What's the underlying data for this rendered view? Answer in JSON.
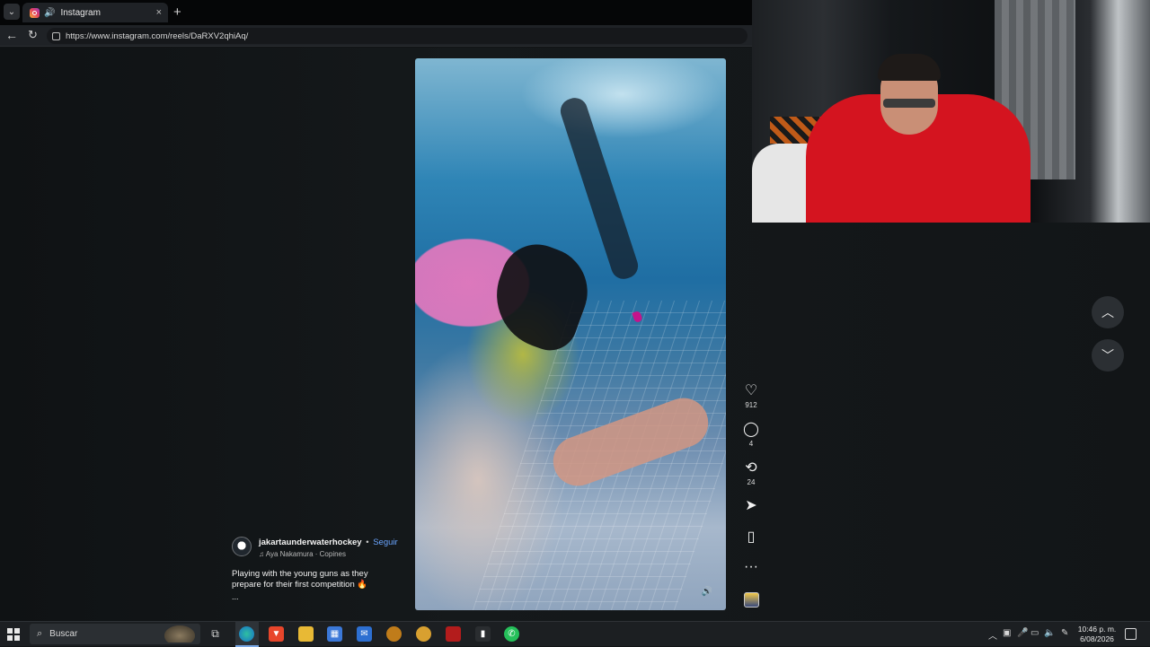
{
  "browser": {
    "tab_title": "Instagram",
    "new_tab": "+",
    "close_tab": "×",
    "url": "https://www.instagram.com/reels/DaRXV2qhiAq/"
  },
  "reel": {
    "username": "jakartaunderwaterhockey",
    "separator": "•",
    "follow_label": "Seguir",
    "audio": "Aya Nakamura · Copines",
    "caption": "Playing with the young guns as they prepare for their first competition 🔥",
    "more": "...",
    "likes": "912",
    "comments": "4",
    "reposts": "24"
  },
  "taskbar": {
    "search_placeholder": "Buscar",
    "time": "10:46 p. m.",
    "date": "6/08/2026"
  },
  "colors": {
    "follow": "#6aa5ff",
    "webcam_hoodie": "#d4141f",
    "cursor": "#c4148b"
  },
  "icons": [
    "chevron-down-icon",
    "instagram-icon",
    "speaker-icon",
    "close-icon",
    "plus-icon",
    "back-icon",
    "reload-icon",
    "site-info-icon",
    "heart-icon",
    "comment-icon",
    "repost-icon",
    "send-icon",
    "bookmark-icon",
    "more-icon",
    "chevron-up-icon",
    "windows-start-icon",
    "search-icon"
  ]
}
